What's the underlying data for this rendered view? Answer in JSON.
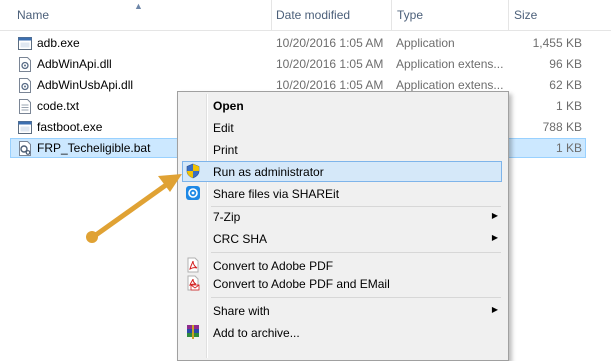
{
  "columns": {
    "name": "Name",
    "date": "Date modified",
    "type": "Type",
    "size": "Size"
  },
  "files": [
    {
      "name": "adb.exe",
      "date": "10/20/2016 1:05 AM",
      "type": "Application",
      "size": "1,455 KB",
      "icon": "exe-icon"
    },
    {
      "name": "AdbWinApi.dll",
      "date": "10/20/2016 1:05 AM",
      "type": "Application extens...",
      "size": "96 KB",
      "icon": "dll-icon"
    },
    {
      "name": "AdbWinUsbApi.dll",
      "date": "10/20/2016 1:05 AM",
      "type": "Application extens...",
      "size": "62 KB",
      "icon": "dll-icon"
    },
    {
      "name": "code.txt",
      "date": "",
      "type": "",
      "size": "1 KB",
      "icon": "text-file-icon"
    },
    {
      "name": "fastboot.exe",
      "date": "",
      "type": "",
      "size": "788 KB",
      "icon": "exe-icon"
    },
    {
      "name": "FRP_Techeligible.bat",
      "date": "",
      "type": "",
      "size": "1 KB",
      "icon": "bat-icon",
      "selected": true
    }
  ],
  "menu": {
    "open": "Open",
    "edit": "Edit",
    "print": "Print",
    "run_admin": "Run as administrator",
    "shareit": "Share files via SHAREit",
    "zip": "7-Zip",
    "crc": "CRC SHA",
    "pdf": "Convert to Adobe PDF",
    "pdf_email": "Convert to Adobe PDF and EMail",
    "share_with": "Share with",
    "add_archive": "Add to archive..."
  },
  "colors": {
    "selection": "#cce8ff",
    "menu_hover": "#d5e8f9",
    "pointer": "#e0a234"
  },
  "icons": [
    "shield-icon",
    "shareit-icon",
    "pdf-icon",
    "pdf-email-icon",
    "winrar-icon",
    "chevron-right-icon"
  ]
}
